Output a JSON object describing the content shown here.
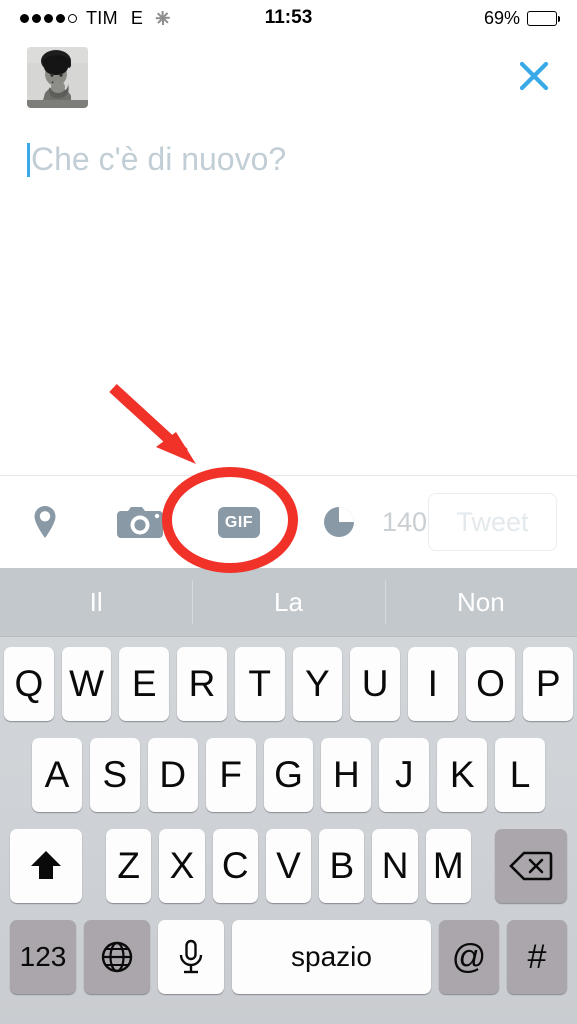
{
  "status_bar": {
    "signal_dots_filled": 4,
    "signal_dots_total": 5,
    "carrier": "TIM",
    "network_type": "E",
    "activity_icon": "spinner-icon",
    "time": "11:53",
    "battery_percent_label": "69%",
    "battery_level": 69
  },
  "composer": {
    "avatar_name": "user-avatar",
    "close_icon": "close-icon",
    "close_color": "#3aa9e8",
    "placeholder": "Che c'è di nuovo?",
    "text_value": "",
    "caret_color": "#3aa9e8"
  },
  "toolbar": {
    "location_icon": "location-pin-icon",
    "camera_icon": "camera-icon",
    "gif_label": "GIF",
    "gif_icon": "gif-icon",
    "gauge_icon": "character-gauge-icon",
    "char_count": "140",
    "tweet_label": "Tweet",
    "icon_color": "#8a99a6",
    "muted_color": "#c9cfd3"
  },
  "annotation": {
    "color": "#f03229",
    "arrow_name": "red-arrow-annotation",
    "circle_name": "red-circle-annotation",
    "target": "gif-icon"
  },
  "keyboard": {
    "predictions": [
      "Il",
      "La",
      "Non"
    ],
    "row1": [
      "Q",
      "W",
      "E",
      "R",
      "T",
      "Y",
      "U",
      "I",
      "O",
      "P"
    ],
    "row2": [
      "A",
      "S",
      "D",
      "F",
      "G",
      "H",
      "J",
      "K",
      "L"
    ],
    "row3": [
      "Z",
      "X",
      "C",
      "V",
      "B",
      "N",
      "M"
    ],
    "shift_icon": "shift-up-arrow-icon",
    "backspace_icon": "backspace-icon",
    "numbers_key": "123",
    "globe_icon": "globe-icon",
    "mic_icon": "microphone-icon",
    "space_label": "spazio",
    "at_key": "@",
    "hash_key": "#"
  }
}
